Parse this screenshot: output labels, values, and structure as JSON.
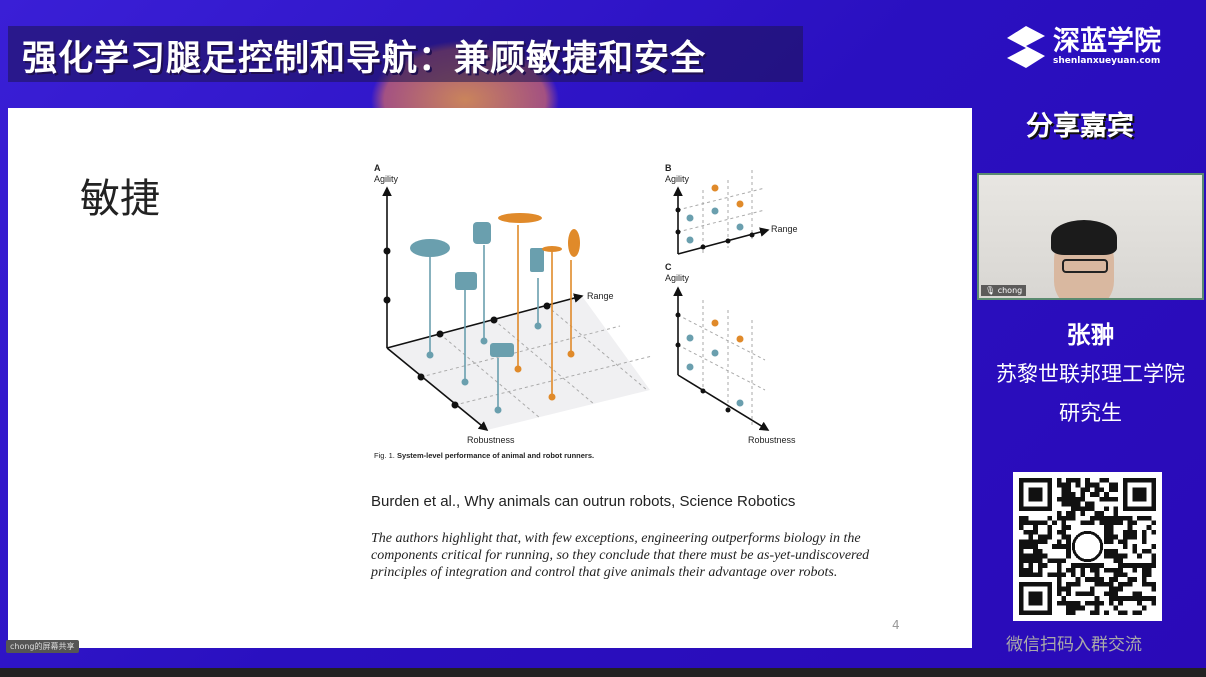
{
  "header": {
    "title": "强化学习腿足控制和导航：兼顾敏捷和安全"
  },
  "slide": {
    "heading": "敏捷",
    "figure": {
      "panel_a": "A",
      "panel_b": "B",
      "panel_c": "C",
      "agility": "Agility",
      "range": "Range",
      "robustness": "Robustness",
      "caption_prefix": "Fig. 1.",
      "caption": "System-level performance of animal and robot runners.",
      "colors": {
        "robot": "#6a9fae",
        "animal": "#e08a2a"
      }
    },
    "citation": "Burden et al., Why animals can outrun robots, Science Robotics",
    "quote": "The authors highlight that, with few exceptions, engineering outperforms biology in the components critical for running, so they conclude that there must be as-yet-undiscovered principles of integration and control that give animals their advantage over robots.",
    "page_number": "4"
  },
  "screen_share_label": "chong的屏幕共享",
  "sidebar": {
    "brand": "深蓝学院",
    "brand_url": "shenlanxueyuan.com",
    "section": "分享嘉宾",
    "webcam_label": "chong",
    "guest_name": "张翀",
    "guest_affiliation": "苏黎世联邦理工学院",
    "guest_role": "研究生",
    "qr_caption": "微信扫码入群交流"
  }
}
